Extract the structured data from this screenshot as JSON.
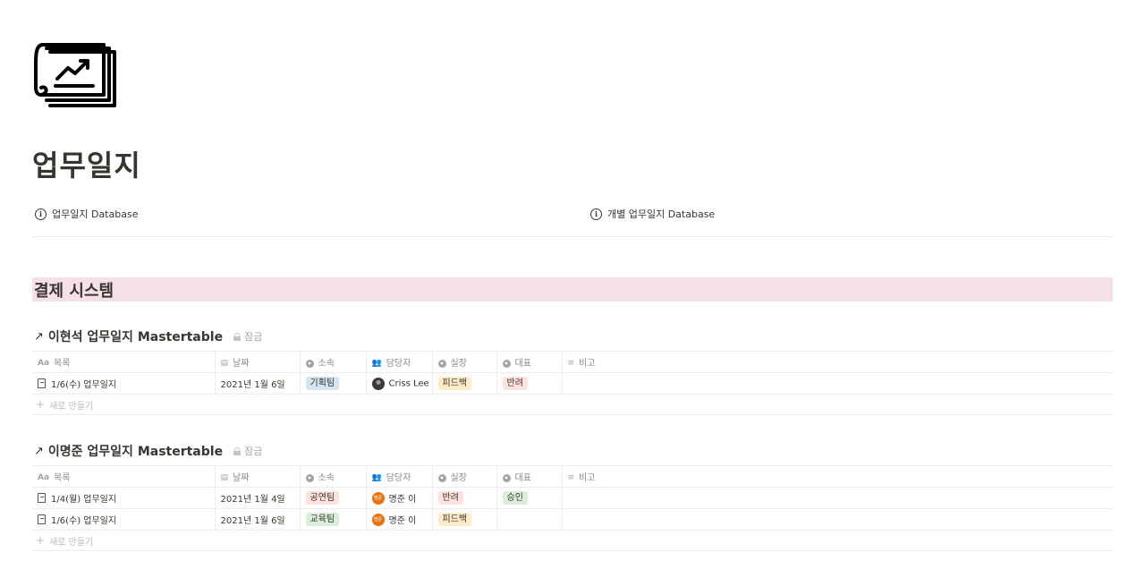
{
  "page": {
    "icon": "newspaper-chart-icon",
    "title": "업무일지"
  },
  "links": [
    {
      "icon": "info-icon",
      "label": "업무일지 Database"
    },
    {
      "icon": "info-icon",
      "label": "개별 업무일지 Database"
    }
  ],
  "section": {
    "title": "결제 시스템",
    "color": "#f5e0e9"
  },
  "columns": {
    "name": "목록",
    "date": "날짜",
    "dept": "소속",
    "owner": "담당자",
    "chief": "실장",
    "ceo": "대표",
    "note": "비고"
  },
  "databases": [
    {
      "title": "이현석 업무일지 Mastertable",
      "lock_label": "잠금",
      "new_label": "새로 만들기",
      "rows": [
        {
          "name": "1/6(수) 업무일지",
          "date": "2021년 1월 6일",
          "dept": "기획팀",
          "owner": "Criss Lee",
          "owner_avatar": "",
          "chief": "피드백",
          "ceo": "반려",
          "note": ""
        }
      ]
    },
    {
      "title": "이명준 업무일지 Mastertable",
      "lock_label": "잠금",
      "new_label": "새로 만들기",
      "rows": [
        {
          "name": "1/4(월) 업무일지",
          "date": "2021년 1월 4일",
          "dept": "공연팀",
          "owner": "명준 이",
          "owner_avatar": "명준",
          "chief": "반려",
          "ceo": "승인",
          "note": ""
        },
        {
          "name": "1/6(수) 업무일지",
          "date": "2021년 1월 6일",
          "dept": "교육팀",
          "owner": "명준 이",
          "owner_avatar": "명준",
          "chief": "피드백",
          "ceo": "",
          "note": ""
        }
      ]
    }
  ],
  "tag_colors": {
    "기획팀": "#d3e5ef",
    "공연팀": "#ffe2dd",
    "교육팀": "#dbeddb",
    "피드백": "#fdecc8",
    "반려": "#ffe2dd",
    "승인": "#dbeddb"
  }
}
